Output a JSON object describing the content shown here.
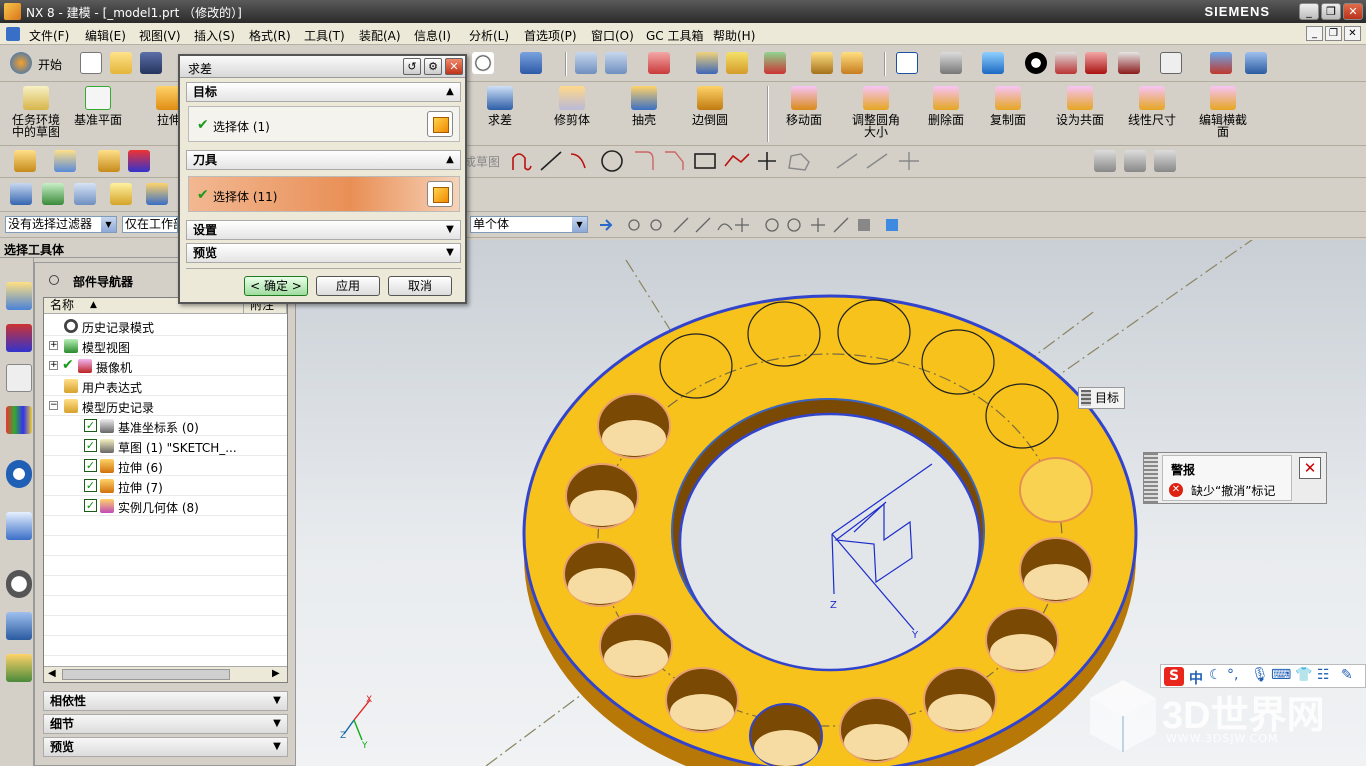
{
  "window": {
    "title": "NX 8 - 建模 - [_model1.prt （修改的）]",
    "brand": "SIEMENS"
  },
  "menu": [
    "文件(F)",
    "编辑(E)",
    "视图(V)",
    "插入(S)",
    "格式(R)",
    "工具(T)",
    "装配(A)",
    "信息(I)",
    "分析(L)",
    "首选项(P)",
    "窗口(O)",
    "GC 工具箱",
    "帮助(H)"
  ],
  "toolbar_standard": {
    "start_label": "开始"
  },
  "toolbar_features": {
    "left_buttons": [
      "任务环境中的草图",
      "基准平面",
      "拉伸"
    ],
    "right_buttons": [
      "求差",
      "修剪体",
      "抽壳",
      "边倒圆",
      "移动面",
      "调整圆角大小",
      "删除面",
      "复制面",
      "设为共面",
      "线性尺寸",
      "编辑横截面"
    ]
  },
  "sketch_toolbar": {
    "partial_label": "成草图"
  },
  "selection_bar": {
    "filter": "没有选择过滤器",
    "scope": "仅在工作部",
    "body_rule": "单个体"
  },
  "cue_line": "选择工具体",
  "dialog": {
    "title": "求差",
    "target_group": "目标",
    "target_selection": "选择体 (1)",
    "tool_group": "刀具",
    "tool_selection": "选择体 (11)",
    "settings_group": "设置",
    "preview_group": "预览",
    "ok": "< 确定 >",
    "apply": "应用",
    "cancel": "取消"
  },
  "part_navigator": {
    "title": "部件导航器",
    "col_name": "名称",
    "col_latest": "附注",
    "items": [
      {
        "label": "历史记录模式"
      },
      {
        "label": "模型视图"
      },
      {
        "label": "摄像机"
      },
      {
        "label": "用户表达式"
      },
      {
        "label": "模型历史记录"
      },
      {
        "label": "基准坐标系 (0)"
      },
      {
        "label": "草图 (1) \"SKETCH_..."
      },
      {
        "label": "拉伸 (6)"
      },
      {
        "label": "拉伸 (7)"
      },
      {
        "label": "实例几何体 (8)"
      }
    ],
    "sections": [
      "相依性",
      "细节",
      "预览"
    ]
  },
  "viewport": {
    "target_tip": "目标",
    "axis_labels": [
      "Z",
      "Y"
    ],
    "triad_labels": [
      "X",
      "Z",
      "Y"
    ]
  },
  "alert": {
    "title": "警报",
    "message": "缺少“撤消”标记"
  },
  "ime": {
    "logo": "S",
    "mode": "中"
  },
  "watermark": {
    "text": "3D世界网",
    "url": "WWW.3DSJW.COM"
  },
  "colors": {
    "part_yellow": "#f7c21b",
    "part_edge": "#3344cc",
    "hole_inner": "#f6dca2",
    "selection_orange": "#e9a070"
  }
}
